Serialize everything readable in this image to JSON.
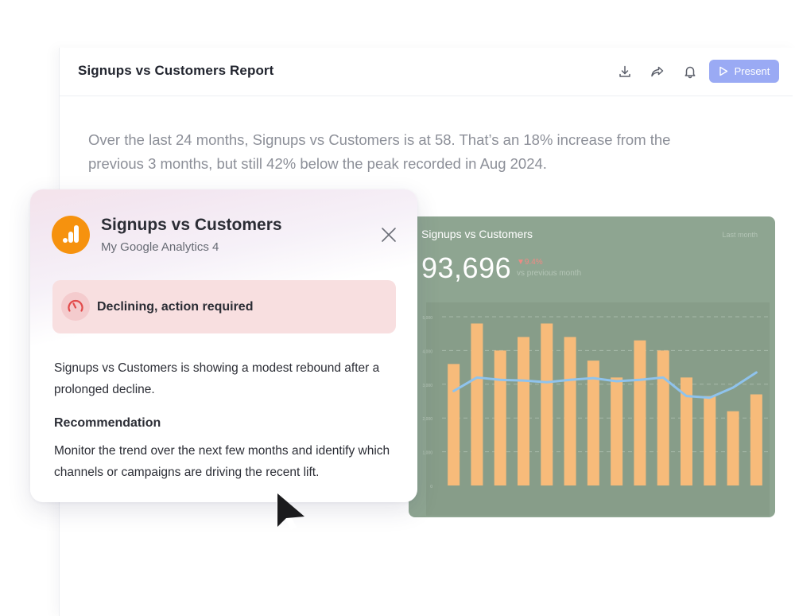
{
  "report": {
    "title": "Signups vs Customers Report",
    "toolbar": {
      "download_icon": "download-icon",
      "share_icon": "share-icon",
      "notification_icon": "bell-icon",
      "present_label": "Present"
    },
    "summary": "Over the last 24 months, Signups vs Customers is at 58. That’s an 18% increase from the previous 3 months, but still 42% below the peak recorded in Aug 2024."
  },
  "widget": {
    "title": "Signups vs Customers",
    "period": "Last month",
    "value": "93,696",
    "change": "9.4%",
    "comparison": "vs previous month"
  },
  "chart_data": {
    "type": "bar",
    "title": "Signups vs Customers",
    "yticks": [
      "0",
      "1,000",
      "2,000",
      "3,000",
      "4,000",
      "5,000"
    ],
    "ylim": [
      0,
      5000
    ],
    "grid": true,
    "series": [
      {
        "values": [
          3600,
          4800,
          4000,
          4400,
          4800,
          4400,
          3700,
          3200,
          4300,
          4000,
          3200,
          2650,
          2200,
          2700
        ]
      },
      {
        "values": [
          2800,
          3200,
          3130,
          3110,
          3060,
          3130,
          3180,
          3090,
          3130,
          3200,
          2650,
          2600,
          2900,
          3350
        ]
      }
    ],
    "colors": {
      "bars": "#f7bb7a",
      "line": "#8fc3ed",
      "background": "#8ea591"
    }
  },
  "insight": {
    "title": "Signups vs Customers",
    "source": "My Google Analytics 4",
    "logo_icon": "google-analytics-icon",
    "close_icon": "close-icon",
    "status_icon": "gauge-icon",
    "status": "Declining, action required",
    "description": "Signups vs Customers is showing a modest rebound after a prolonged decline.",
    "recommendation_heading": "Recommendation",
    "recommendation": "Monitor the trend over the next few months and identify which channels or campaigns are driving the recent lift."
  },
  "colors": {
    "accent": "#9aaaf4",
    "logo": "#f6920e",
    "alert_bg": "#f8dfe0",
    "alert_icon": "#e24b4b"
  }
}
